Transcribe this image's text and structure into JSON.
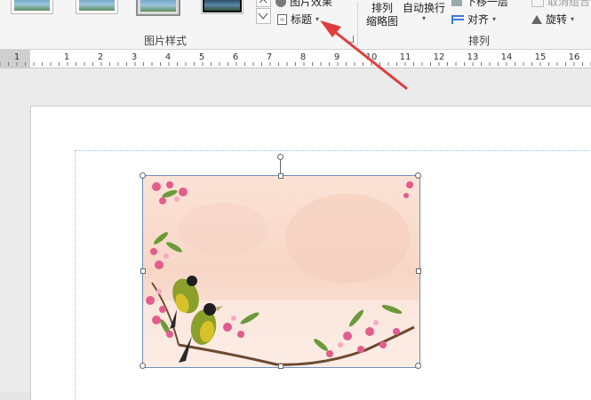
{
  "ribbon": {
    "picture_effects_label": "图片效果",
    "caption_label": "标题",
    "group_picture_styles": "图片样式",
    "arrange_thumbnail_line1": "排列",
    "arrange_thumbnail_line2": "缩略图",
    "text_wrap_label": "自动换行",
    "send_backward_label": "下移一层",
    "align_label": "对齐",
    "ungroup_label": "取消组合",
    "rotate_label": "旋转",
    "group_arrange": "排列"
  },
  "ruler": {
    "labels": [
      "1",
      "1",
      "2",
      "3",
      "4",
      "5",
      "6",
      "7",
      "8",
      "9",
      "10",
      "11",
      "12",
      "13",
      "14",
      "15",
      "16"
    ]
  },
  "colors": {
    "arrow": "#e03c3c",
    "selection_border": "#6b8fb8",
    "margin_guide": "#9cc4e4"
  }
}
